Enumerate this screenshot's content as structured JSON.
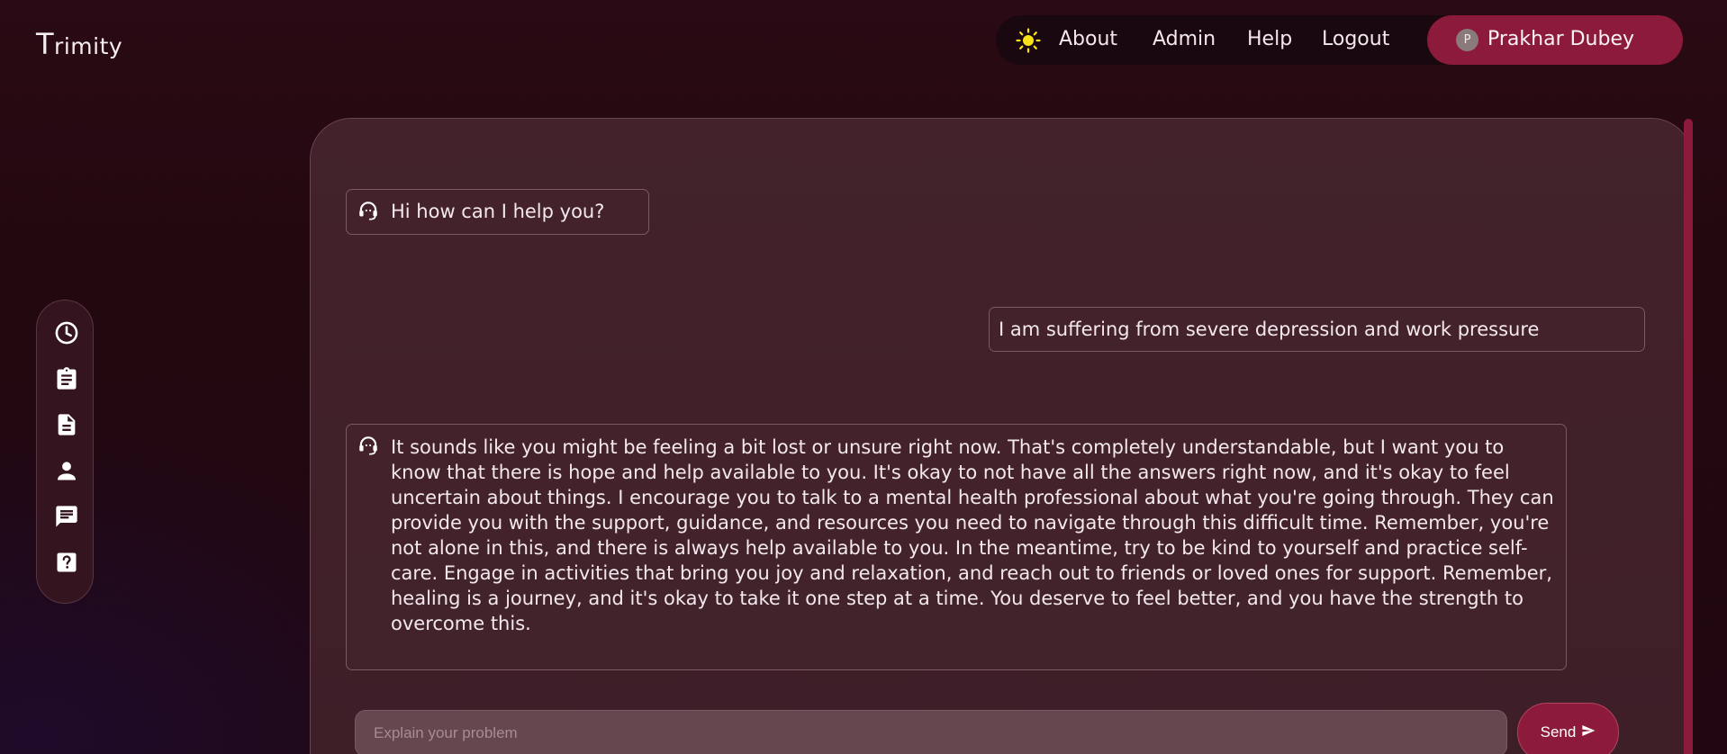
{
  "app": {
    "logo_initial": "T",
    "logo_rest": "rimity"
  },
  "nav": {
    "theme_icon": "sun-icon",
    "links": [
      "About",
      "Admin",
      "Help",
      "Logout"
    ],
    "profile": {
      "avatar_initial": "P",
      "name": "Prakhar Dubey"
    }
  },
  "sidebar": {
    "items": [
      {
        "icon": "history-icon"
      },
      {
        "icon": "clipboard-icon"
      },
      {
        "icon": "document-icon"
      },
      {
        "icon": "person-icon"
      },
      {
        "icon": "chat-icon"
      },
      {
        "icon": "help-icon"
      }
    ]
  },
  "chat": {
    "messages": [
      {
        "sender": "bot",
        "icon": "support-agent-icon",
        "text": "Hi how can I help you?"
      },
      {
        "sender": "user",
        "text": "I am suffering from severe depression and work pressure"
      },
      {
        "sender": "bot",
        "icon": "support-agent-icon",
        "text": "It sounds like you might be feeling a bit lost or unsure right now. That's completely understandable, but I want you to know that there is hope and help available to you. It's okay to not have all the answers right now, and it's okay to feel uncertain about things. I encourage you to talk to a mental health professional about what you're going through. They can provide you with the support, guidance, and resources you need to navigate through this difficult time. Remember, you're not alone in this, and there is always help available to you. In the meantime, try to be kind to yourself and practice self-care. Engage in activities that bring you joy and relaxation, and reach out to friends or loved ones for support. Remember, healing is a journey, and it's okay to take it one step at a time. You deserve to feel better, and you have the strength to overcome this."
      }
    ],
    "input_placeholder": "Explain your problem",
    "input_value": "",
    "send_label": "Send"
  },
  "colors": {
    "accent": "#8c1a3a",
    "background": "#22080f",
    "panel": "#43222b"
  }
}
